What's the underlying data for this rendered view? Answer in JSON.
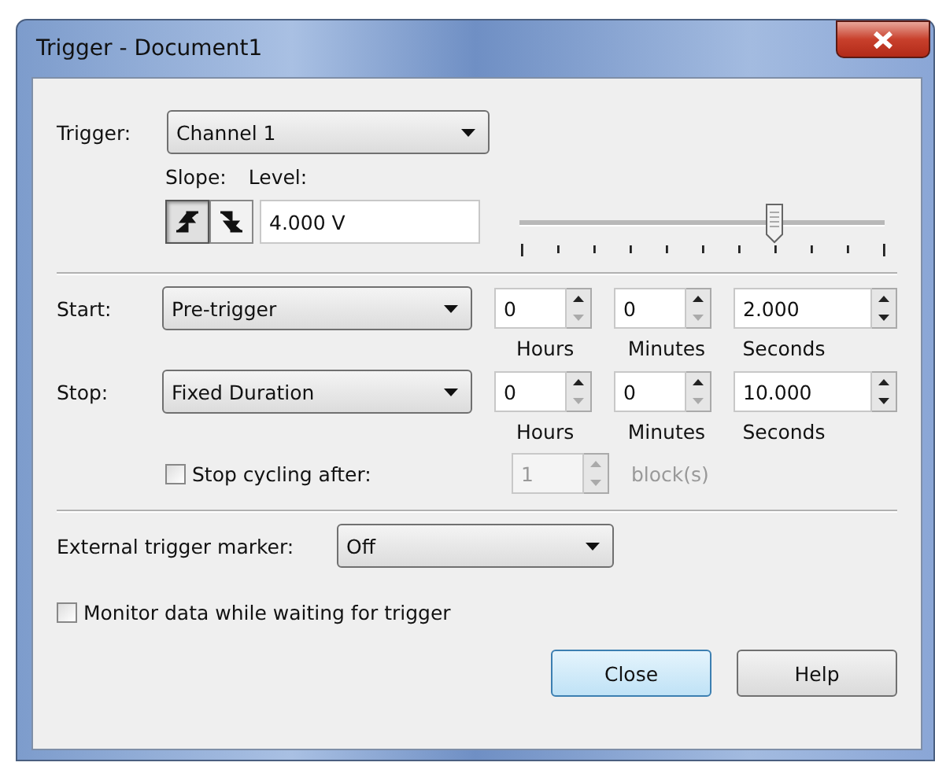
{
  "window": {
    "title": "Trigger - Document1"
  },
  "trigger": {
    "label": "Trigger:",
    "value": "Channel 1"
  },
  "slope": {
    "label": "Slope:",
    "options": [
      {
        "kind": "rising",
        "selected": true
      },
      {
        "kind": "falling",
        "selected": false
      }
    ]
  },
  "level": {
    "label": "Level:",
    "value": "4.000 V",
    "level": 0.7
  },
  "rows": [
    {
      "label": "Start:",
      "value": "Pre-trigger",
      "spinners": [
        {
          "value": "0",
          "unit": "Hours",
          "down_enabled": false
        },
        {
          "value": "0",
          "unit": "Minutes",
          "down_enabled": false
        },
        {
          "value": "2.000",
          "unit": "Seconds",
          "down_enabled": true
        }
      ]
    },
    {
      "label": "Stop:",
      "value": "Fixed Duration",
      "spinners": [
        {
          "value": "0",
          "unit": "Hours",
          "down_enabled": false
        },
        {
          "value": "0",
          "unit": "Minutes",
          "down_enabled": false
        },
        {
          "value": "10.000",
          "unit": "Seconds",
          "down_enabled": true
        }
      ]
    }
  ],
  "stop_cycling": {
    "label": "Stop cycling after:",
    "checked": false,
    "count": "1",
    "unit": "block(s)",
    "disabled": true
  },
  "external_marker": {
    "label": "External trigger marker:",
    "value": "Off"
  },
  "monitor": {
    "label": "Monitor data while waiting for trigger",
    "checked": false
  },
  "buttons": [
    {
      "label": "Close",
      "default": true
    },
    {
      "label": "Help",
      "default": false
    }
  ]
}
